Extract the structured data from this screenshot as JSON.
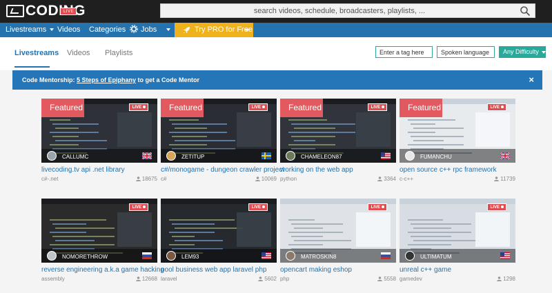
{
  "header": {
    "logo_left": "LIVE",
    "logo_right": "CODING",
    "search_placeholder": "search videos, schedule, broadcasters, playlists, ..."
  },
  "nav": {
    "items": [
      {
        "label": "Livestreams"
      },
      {
        "label": "Videos"
      },
      {
        "label": "Categories"
      },
      {
        "label": "Jobs"
      }
    ],
    "pro": "Try PRO for Free"
  },
  "tabs": [
    "Livestreams",
    "Videos",
    "Playlists"
  ],
  "filters": {
    "tag_placeholder": "Enter a tag here",
    "language_placeholder": "Spoken language",
    "difficulty": "Any Difficulty"
  },
  "banner": {
    "prefix": "Code Mentorship: ",
    "link": "5 Steps of Epiphany",
    "suffix": " to get a Code Mentor",
    "close": "×"
  },
  "featured_label": "Featured",
  "live_label": "LIVE",
  "streams": [
    {
      "username": "CALLUMC",
      "title": "livecoding.tv api .net library",
      "tag": "c#-.net",
      "viewers": "18675",
      "flag": "uk",
      "featured": true,
      "avatar": "#9aa3ab"
    },
    {
      "username": "ZETITUP",
      "title": "c#/monogame - dungeon crawler project",
      "tag": "c#",
      "viewers": "10069",
      "flag": "se",
      "featured": true,
      "avatar": "#d9a35a"
    },
    {
      "username": "CHAMELEON87",
      "title": "working on the web app",
      "tag": "python",
      "viewers": "3364",
      "flag": "us",
      "featured": true,
      "avatar": "#6b7b5a"
    },
    {
      "username": "FUMANCHU",
      "title": "open source c++ rpc framework",
      "tag": "c-c++",
      "viewers": "11739",
      "flag": "uk",
      "featured": true,
      "avatar": "#e8e8e8"
    },
    {
      "username": "NOMORETHROW",
      "title": "reverse engineering a.k.a game hacking",
      "tag": "assembly",
      "viewers": "12668",
      "flag": "ru",
      "featured": false,
      "avatar": "#bfc5c9"
    },
    {
      "username": "LEM93",
      "title": "pool business web app laravel php",
      "tag": "laravel",
      "viewers": "5602",
      "flag": "us",
      "featured": false,
      "avatar": "#7a5a45"
    },
    {
      "username": "MATROSKIN8",
      "title": "opencart making eshop",
      "tag": "php",
      "viewers": "5558",
      "flag": "ru",
      "featured": false,
      "avatar": "#8c7a6a"
    },
    {
      "username": "ULTIMATUM",
      "title": "unreal c++ game",
      "tag": "gamedev",
      "viewers": "1298",
      "flag": "us",
      "featured": false,
      "avatar": "#333333"
    }
  ],
  "colors": {
    "brand_blue": "#2473ae",
    "pro_yellow": "#f0b21c",
    "teal": "#2aa89a",
    "featured_red": "#e25a5f"
  }
}
